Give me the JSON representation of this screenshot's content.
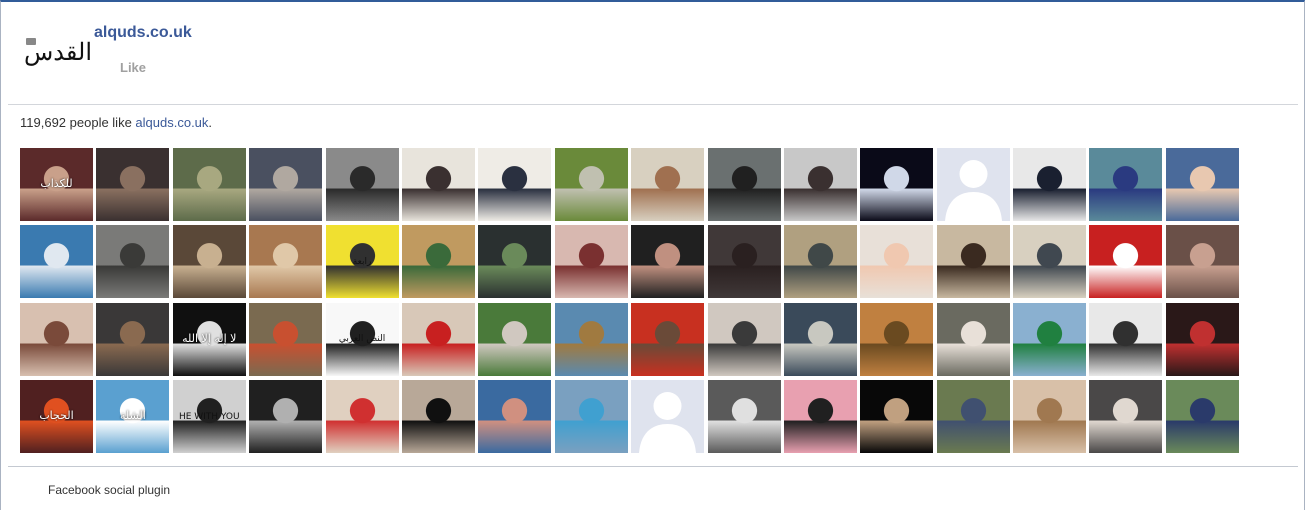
{
  "header": {
    "page_name": "alquds.co.uk",
    "like_label": "Like",
    "logo_text": "القدس"
  },
  "summary": {
    "count": "119,692",
    "text_middle": " people like ",
    "link": "alquds.co.uk",
    "end": "."
  },
  "footer": {
    "label": "Facebook social plugin"
  },
  "faces": [
    {
      "bg": "#5b2a2a",
      "accent": "#c9a08a",
      "text": "للكذاب"
    },
    {
      "bg": "#3a3030",
      "accent": "#8a7060"
    },
    {
      "bg": "#5d6b4a",
      "accent": "#a8a880"
    },
    {
      "bg": "#4a5060",
      "accent": "#b0a8a0"
    },
    {
      "bg": "#8a8a8a",
      "accent": "#2a2a2a"
    },
    {
      "bg": "#e8e4dc",
      "accent": "#3a3030"
    },
    {
      "bg": "#efece6",
      "accent": "#2a3040"
    },
    {
      "bg": "#6a8a3a",
      "accent": "#c0c0b0"
    },
    {
      "bg": "#d8d0c0",
      "accent": "#a07050"
    },
    {
      "bg": "#6a7070",
      "accent": "#202020"
    },
    {
      "bg": "#c8c8c8",
      "accent": "#3a3030"
    },
    {
      "bg": "#0a0a18",
      "accent": "#d0d8e8"
    },
    {
      "bg": "#dfe3ee",
      "accent": "#ffffff",
      "silhouette": true
    },
    {
      "bg": "#e8e8e8",
      "accent": "#1a2030"
    },
    {
      "bg": "#5a8a9a",
      "accent": "#2a3a80"
    },
    {
      "bg": "#4a6a9a",
      "accent": "#e8c8b0"
    },
    {
      "bg": "#3a7ab0",
      "accent": "#e0e8f0"
    },
    {
      "bg": "#7a7a78",
      "accent": "#3a3a38"
    },
    {
      "bg": "#5a4838",
      "accent": "#c8b090"
    },
    {
      "bg": "#a87850",
      "accent": "#e0c8a8"
    },
    {
      "bg": "#f0e030",
      "accent": "#303030",
      "text": "رابعة",
      "dark": true
    },
    {
      "bg": "#c09a60",
      "accent": "#3a6a3a"
    },
    {
      "bg": "#2a3030",
      "accent": "#6a8a5a"
    },
    {
      "bg": "#d8b8b0",
      "accent": "#7a3030"
    },
    {
      "bg": "#202020",
      "accent": "#c09080"
    },
    {
      "bg": "#403838",
      "accent": "#2a2020"
    },
    {
      "bg": "#b0a080",
      "accent": "#404848"
    },
    {
      "bg": "#e8e0d8",
      "accent": "#f0c8b0"
    },
    {
      "bg": "#c8b8a0",
      "accent": "#3a2a20"
    },
    {
      "bg": "#d8d0c0",
      "accent": "#404850"
    },
    {
      "bg": "#c82020",
      "accent": "#ffffff"
    },
    {
      "bg": "#6a5048",
      "accent": "#c8a090"
    },
    {
      "bg": "#d8c0b0",
      "accent": "#7a4a3a"
    },
    {
      "bg": "#3a3838",
      "accent": "#8a6a50"
    },
    {
      "bg": "#101010",
      "accent": "#e0e0e0",
      "text": "لا إله إلا الله"
    },
    {
      "bg": "#7a6a50",
      "accent": "#c85030"
    },
    {
      "bg": "#f8f8f8",
      "accent": "#202020",
      "text": "النص العربي",
      "dark": true
    },
    {
      "bg": "#d8c8b8",
      "accent": "#c82020"
    },
    {
      "bg": "#4a7a3a",
      "accent": "#d0c8c0"
    },
    {
      "bg": "#5a8ab0",
      "accent": "#a07a40"
    },
    {
      "bg": "#c83020",
      "accent": "#6a4a38"
    },
    {
      "bg": "#d0c8c0",
      "accent": "#3a3a3a"
    },
    {
      "bg": "#3a4a5a",
      "accent": "#c8c8c0"
    },
    {
      "bg": "#c08040",
      "accent": "#6a4a20"
    },
    {
      "bg": "#6a6a60",
      "accent": "#e8e0d8"
    },
    {
      "bg": "#8ab0d0",
      "accent": "#208040"
    },
    {
      "bg": "#e8e8e8",
      "accent": "#303030"
    },
    {
      "bg": "#2a1818",
      "accent": "#c03030"
    },
    {
      "bg": "#502020",
      "accent": "#e05020",
      "text": "الحجاب"
    },
    {
      "bg": "#5aa0d0",
      "accent": "#ffffff",
      "text": "الشلة"
    },
    {
      "bg": "#d0d0d0",
      "accent": "#202020",
      "text": "HE WITH YOU",
      "dark": true
    },
    {
      "bg": "#202020",
      "accent": "#b0b0b0"
    },
    {
      "bg": "#e0d0c0",
      "accent": "#d03030"
    },
    {
      "bg": "#b8a898",
      "accent": "#101010"
    },
    {
      "bg": "#3a6aa0",
      "accent": "#d09080"
    },
    {
      "bg": "#7aa0c0",
      "accent": "#40a0d0"
    },
    {
      "bg": "#dfe3ee",
      "accent": "#ffffff",
      "silhouette": true
    },
    {
      "bg": "#5a5a5a",
      "accent": "#e0e0e0"
    },
    {
      "bg": "#e8a0b0",
      "accent": "#202020"
    },
    {
      "bg": "#080808",
      "accent": "#c0a080"
    },
    {
      "bg": "#6a7a50",
      "accent": "#405070"
    },
    {
      "bg": "#d8c0a8",
      "accent": "#a07850"
    },
    {
      "bg": "#4a4848",
      "accent": "#e0d8d0"
    },
    {
      "bg": "#6a8a5a",
      "accent": "#2a3a6a"
    }
  ]
}
